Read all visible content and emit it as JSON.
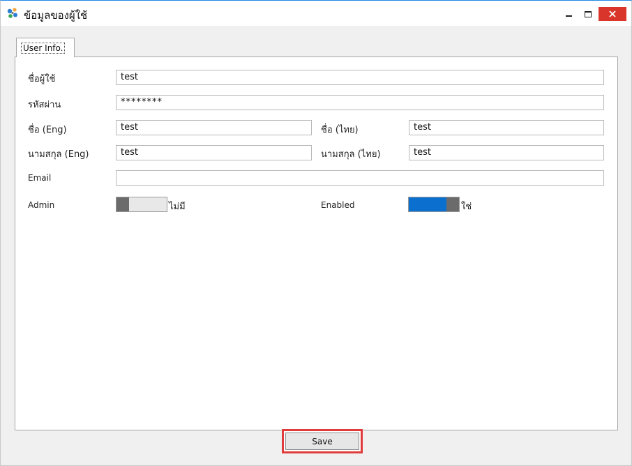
{
  "window": {
    "title": "ข้อมูลของผู้ใช้",
    "icon": "app-logo-icon",
    "controls": [
      "minimize-icon",
      "maximize-icon",
      "close-icon"
    ],
    "accent_color": "#1e88e5",
    "close_color": "#d9352b"
  },
  "tabs": [
    {
      "label": "User Info.",
      "selected": true
    }
  ],
  "form": {
    "username": {
      "label": "ชื่อผู้ใช้",
      "value": "test"
    },
    "password": {
      "label": "รหัสผ่าน",
      "value": "********"
    },
    "first_name_en": {
      "label": "ชื่อ (Eng)",
      "value": "test"
    },
    "first_name_th": {
      "label": "ชื่อ (ไทย)",
      "value": "test"
    },
    "last_name_en": {
      "label": "นามสกุล (Eng)",
      "value": "test"
    },
    "last_name_th": {
      "label": "นามสกุล (ไทย)",
      "value": "test"
    },
    "email": {
      "label": "Email",
      "value": ""
    },
    "admin": {
      "label": "Admin",
      "state_text": "ไม่มี",
      "on": false
    },
    "enabled": {
      "label": "Enabled",
      "state_text": "ใช่",
      "on": true,
      "color": "#0a6fcf"
    }
  },
  "actions": {
    "save_label": "Save",
    "highlight_color": "#e03c3c"
  }
}
